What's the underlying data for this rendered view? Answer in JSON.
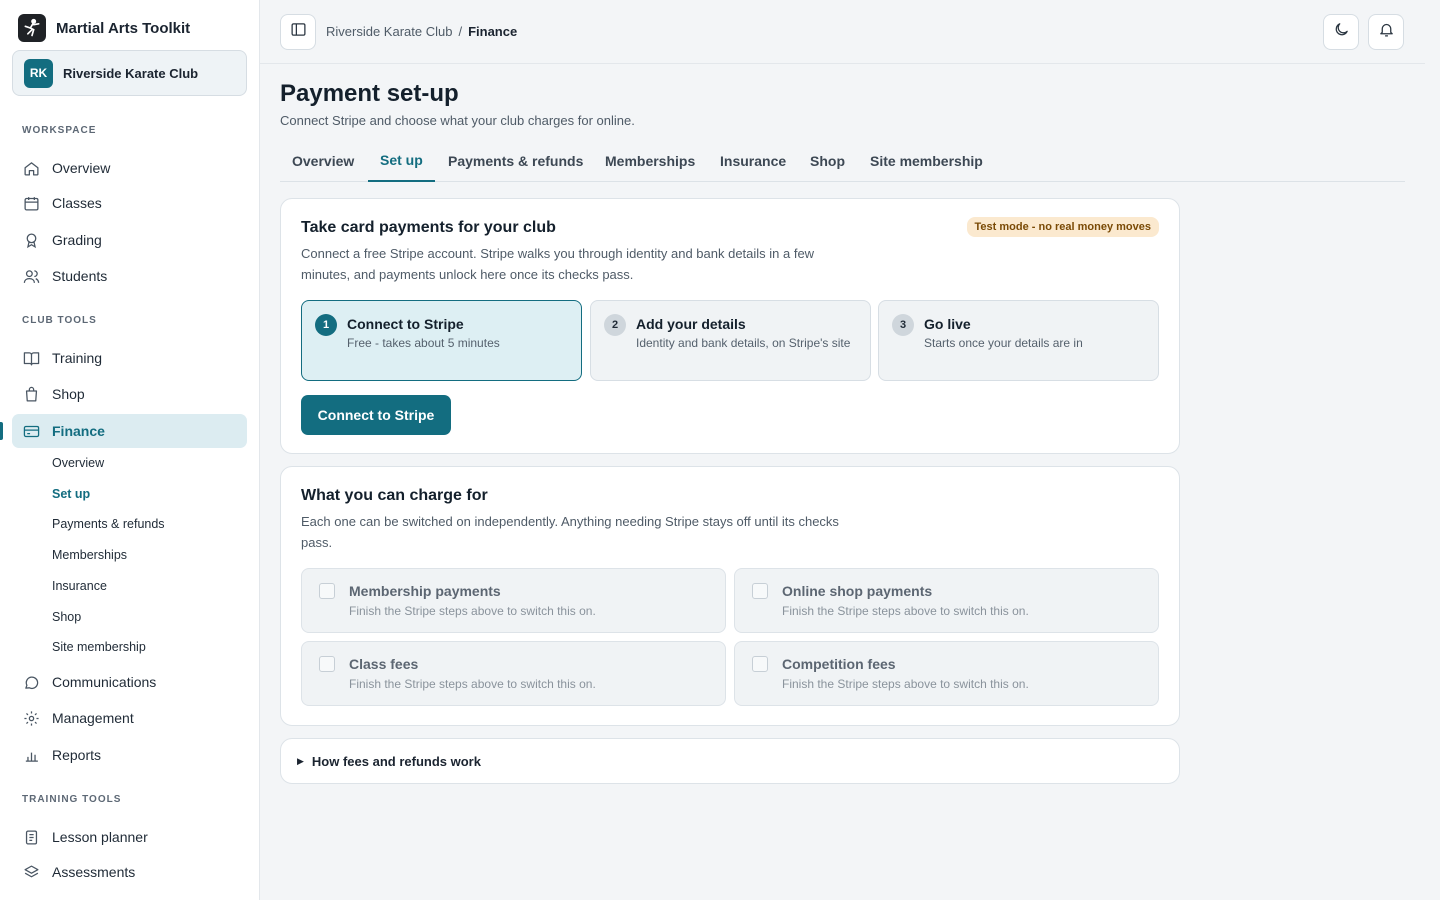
{
  "brand": {
    "name": "Martial Arts Toolkit",
    "logo_icon": "martial-artist-icon"
  },
  "club": {
    "initials": "RK",
    "name": "Riverside Karate Club"
  },
  "sidebar": {
    "sections": {
      "workspace": "WORKSPACE",
      "club_tools": "CLUB TOOLS",
      "training_tools": "TRAINING TOOLS"
    },
    "workspace_items": [
      {
        "label": "Overview",
        "icon": "home-icon"
      },
      {
        "label": "Classes",
        "icon": "calendar-icon"
      },
      {
        "label": "Grading",
        "icon": "award-icon"
      },
      {
        "label": "Students",
        "icon": "users-icon"
      }
    ],
    "club_items": [
      {
        "label": "Training",
        "icon": "book-icon"
      },
      {
        "label": "Shop",
        "icon": "shopping-bag-icon"
      },
      {
        "label": "Finance",
        "icon": "credit-card-icon",
        "active": true
      }
    ],
    "finance_sub": [
      {
        "label": "Overview"
      },
      {
        "label": "Set up",
        "active": true
      },
      {
        "label": "Payments & refunds"
      },
      {
        "label": "Memberships"
      },
      {
        "label": "Insurance"
      },
      {
        "label": "Shop"
      },
      {
        "label": "Site membership"
      }
    ],
    "more_items": [
      {
        "label": "Communications",
        "icon": "message-icon"
      },
      {
        "label": "Management",
        "icon": "gear-icon"
      },
      {
        "label": "Reports",
        "icon": "bar-chart-icon"
      }
    ],
    "training_items": [
      {
        "label": "Lesson planner",
        "icon": "clipboard-icon"
      },
      {
        "label": "Assessments",
        "icon": "layers-icon"
      }
    ]
  },
  "topbar": {
    "breadcrumb": {
      "parent": "Riverside Karate Club",
      "separator": "/",
      "current": "Finance"
    }
  },
  "page": {
    "title": "Payment set-up",
    "subtitle": "Connect Stripe and choose what your club charges for online."
  },
  "tabs": [
    {
      "label": "Overview"
    },
    {
      "label": "Set up",
      "active": true
    },
    {
      "label": "Payments & refunds"
    },
    {
      "label": "Memberships"
    },
    {
      "label": "Insurance"
    },
    {
      "label": "Shop"
    },
    {
      "label": "Site membership"
    }
  ],
  "stripe_card": {
    "title": "Take card payments for your club",
    "badge": "Test mode - no real money moves",
    "description": "Connect a free Stripe account. Stripe walks you through identity and bank details in a few minutes, and payments unlock here once its checks pass.",
    "steps": [
      {
        "num": "1",
        "title": "Connect to Stripe",
        "desc": "Free - takes about 5 minutes",
        "active": true
      },
      {
        "num": "2",
        "title": "Add your details",
        "desc": "Identity and bank details, on Stripe's site"
      },
      {
        "num": "3",
        "title": "Go live",
        "desc": "Starts once your details are in"
      }
    ],
    "button": "Connect to Stripe"
  },
  "charge_card": {
    "title": "What you can charge for",
    "description": "Each one can be switched on independently. Anything needing Stripe stays off until its checks pass.",
    "options": [
      {
        "title": "Membership payments",
        "desc": "Finish the Stripe steps above to switch this on."
      },
      {
        "title": "Online shop payments",
        "desc": "Finish the Stripe steps above to switch this on."
      },
      {
        "title": "Class fees",
        "desc": "Finish the Stripe steps above to switch this on."
      },
      {
        "title": "Competition fees",
        "desc": "Finish the Stripe steps above to switch this on."
      }
    ]
  },
  "accordion": {
    "label": "How fees and refunds work"
  },
  "colors": {
    "accent": "#136d80",
    "badge_bg": "#fbe9cf",
    "badge_text": "#7a4a06"
  }
}
